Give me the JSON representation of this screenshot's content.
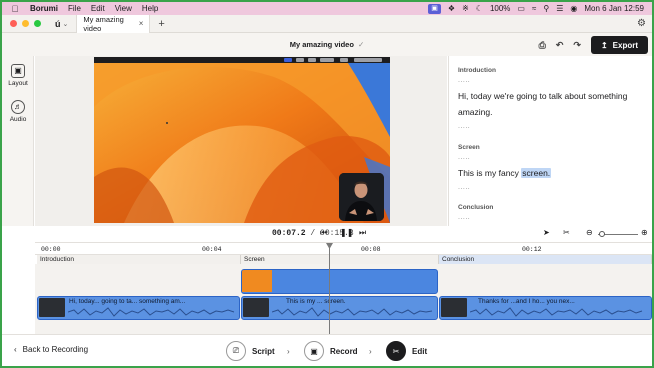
{
  "menubar": {
    "app": "Borumi",
    "items": [
      "File",
      "Edit",
      "View",
      "Help"
    ],
    "battery": "100%",
    "datetime": "Mon 6 Jan  12:59"
  },
  "titlebar": {
    "tab_title": "My amazing video"
  },
  "header": {
    "project_title": "My amazing video",
    "export_label": "Export"
  },
  "left_toolbar": {
    "layout_label": "Layout",
    "audio_label": "Audio"
  },
  "transcript": {
    "sections": [
      {
        "heading": "Introduction",
        "dots_before": ".....",
        "text": "Hi, today we're going to talk about something amazing.",
        "dots_after": "....."
      },
      {
        "heading": "Screen",
        "dots_before": ".....",
        "text_plain": "This is my fancy ",
        "text_highlight": "screen.",
        "dots_after": "....."
      },
      {
        "heading": "Conclusion",
        "dots_before": "....."
      }
    ]
  },
  "playback": {
    "current": "00:07.2",
    "separator": "/",
    "total": "00:15.3"
  },
  "timeline": {
    "ruler": [
      "00:00",
      "00:04",
      "00:08",
      "00:12"
    ],
    "sections": [
      "Introduction",
      "Screen",
      "Conclusion"
    ],
    "audio_clips": [
      "Hi, today... going to ta... something am...",
      "This is my ... screen.",
      "Thanks for ...and I ho...  you nex..."
    ]
  },
  "bottom": {
    "back_label": "Back to Recording",
    "steps": [
      "Script",
      "Record",
      "Edit"
    ],
    "active_step": "Edit"
  },
  "colors": {
    "accent_blue": "#4b86e0",
    "highlight": "#bfd6f5",
    "menubar_bg": "#efc8dd"
  }
}
